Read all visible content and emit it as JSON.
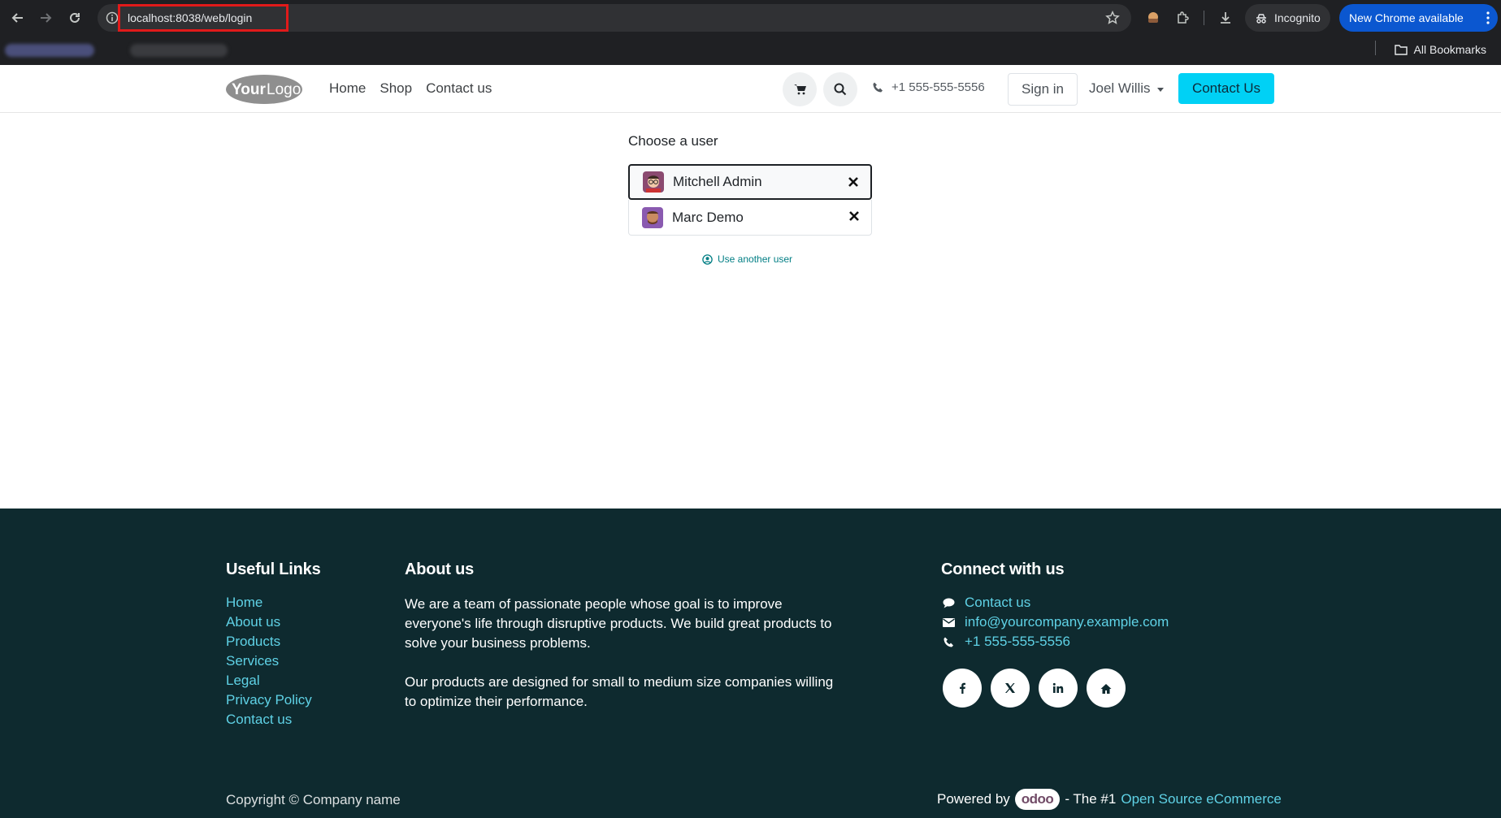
{
  "browser": {
    "url": "localhost:8038/web/login",
    "incognito_label": "Incognito",
    "update_label": "New Chrome available",
    "bookmarks_label": "All Bookmarks"
  },
  "header": {
    "logo_text": "YourLogo",
    "nav": [
      "Home",
      "Shop",
      "Contact us"
    ],
    "phone": "+1 555-555-5556",
    "signin_label": "Sign in",
    "user_name": "Joel Willis",
    "cta_label": "Contact Us"
  },
  "login": {
    "title": "Choose a user",
    "users": [
      {
        "name": "Mitchell Admin",
        "selected": true
      },
      {
        "name": "Marc Demo",
        "selected": false
      }
    ],
    "use_another_label": "Use another user"
  },
  "footer": {
    "useful_links_title": "Useful Links",
    "useful_links": [
      "Home",
      "About us",
      "Products",
      "Services",
      "Legal",
      "Privacy Policy",
      "Contact us"
    ],
    "about_title": "About us",
    "about_p1": "We are a team of passionate people whose goal is to improve everyone's life through disruptive products. We build great products to solve your business problems.",
    "about_p2": "Our products are designed for small to medium size companies willing to optimize their performance.",
    "connect_title": "Connect with us",
    "connect": {
      "contact": "Contact us",
      "email": "info@yourcompany.example.com",
      "phone": "+1 555-555-5556"
    },
    "socials": [
      "facebook-icon",
      "x-icon",
      "linkedin-icon",
      "home-icon"
    ],
    "copyright": "Copyright © Company name",
    "powered_prefix": "Powered by",
    "powered_brand": "odoo",
    "powered_middle": "- The #1",
    "powered_link": "Open Source eCommerce"
  },
  "colors": {
    "accent": "#00d1f5",
    "footer_bg": "#0e2a2f",
    "link": "#5fd2e6",
    "url_highlight": "#e11a1a"
  }
}
